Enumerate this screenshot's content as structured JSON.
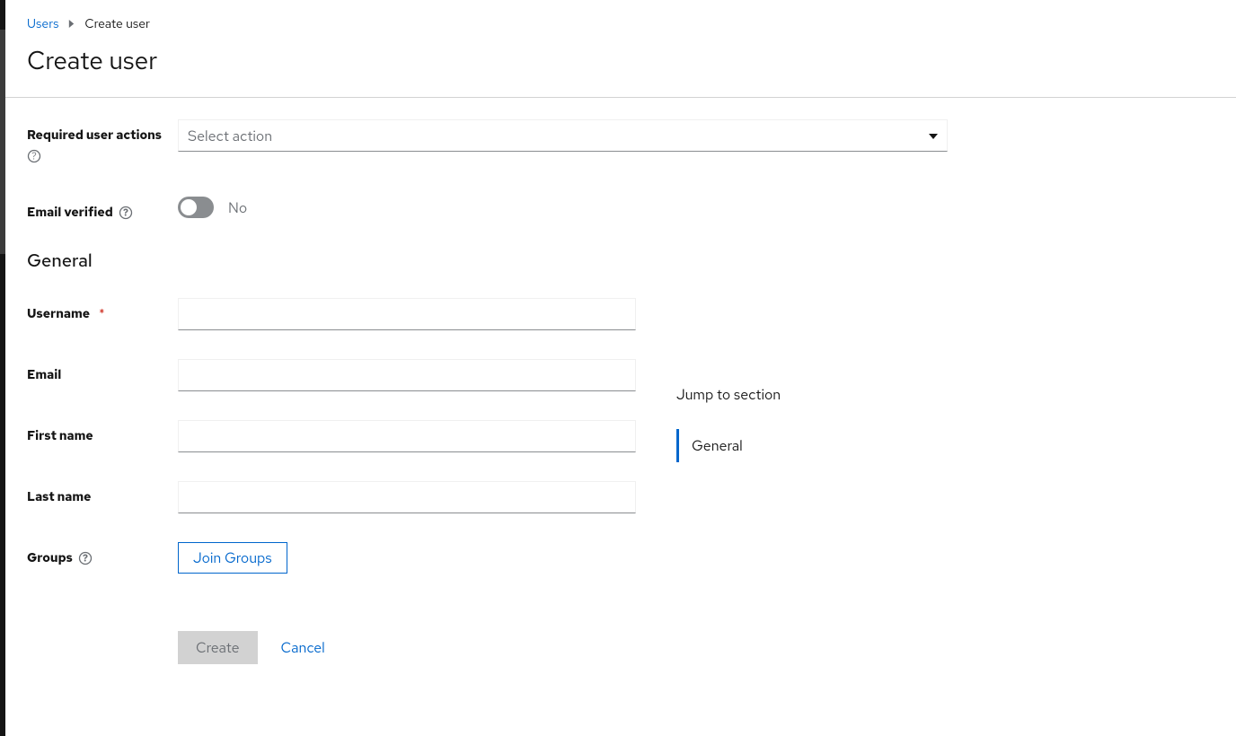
{
  "breadcrumb": {
    "parent": "Users",
    "current": "Create user"
  },
  "page_title": "Create user",
  "form": {
    "required_actions": {
      "label": "Required user actions",
      "placeholder": "Select action"
    },
    "email_verified": {
      "label": "Email verified",
      "value_label": "No"
    },
    "section_heading": "General",
    "username": {
      "label": "Username",
      "value": ""
    },
    "email": {
      "label": "Email",
      "value": ""
    },
    "first_name": {
      "label": "First name",
      "value": ""
    },
    "last_name": {
      "label": "Last name",
      "value": ""
    },
    "groups": {
      "label": "Groups",
      "button": "Join Groups"
    },
    "actions": {
      "create": "Create",
      "cancel": "Cancel"
    }
  },
  "jump": {
    "heading": "Jump to section",
    "items": [
      "General"
    ]
  }
}
